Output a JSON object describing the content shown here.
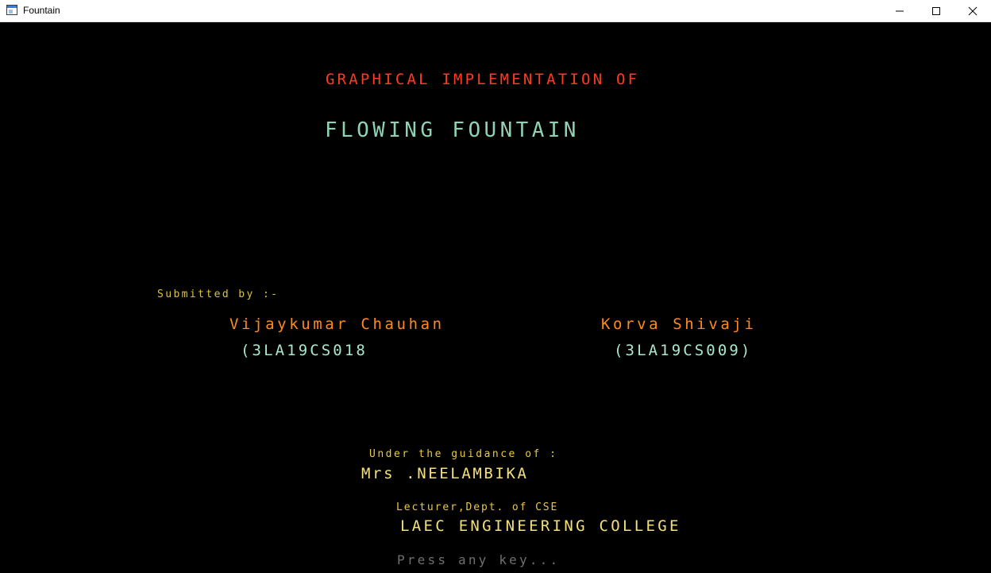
{
  "window": {
    "title": "Fountain",
    "icon": "app-window-icon",
    "controls": {
      "minimize_icon": "minimize-icon",
      "maximize_icon": "maximize-icon",
      "close_icon": "close-icon"
    }
  },
  "screen": {
    "heading": "GRAPHICAL IMPLEMENTATION OF",
    "title": "FLOWING FOUNTAIN",
    "submitted_label": "Submitted by :-",
    "students": [
      {
        "name": "Vijaykumar Chauhan",
        "id": "(3LA19CS018"
      },
      {
        "name": "Korva Shivaji",
        "id": "(3LA19CS009)"
      }
    ],
    "guidance_label": "Under the guidance of :",
    "guide_name": "Mrs .NEELAMBIKA",
    "guide_designation": "Lecturer,Dept. of CSE",
    "college": "LAEC ENGINEERING COLLEGE",
    "prompt": "Press any key..."
  },
  "colors": {
    "background": "#000000",
    "heading": "#ff3a1e",
    "title": "#8fd3b4",
    "submitted": "#d9c63a",
    "student_name": "#ff8a1c",
    "student_id": "#a8e8cc",
    "guidance": "#e8c84a",
    "guide_name": "#f4e07a",
    "designation": "#e8c84a",
    "college": "#f4e07a",
    "prompt": "#707070"
  }
}
